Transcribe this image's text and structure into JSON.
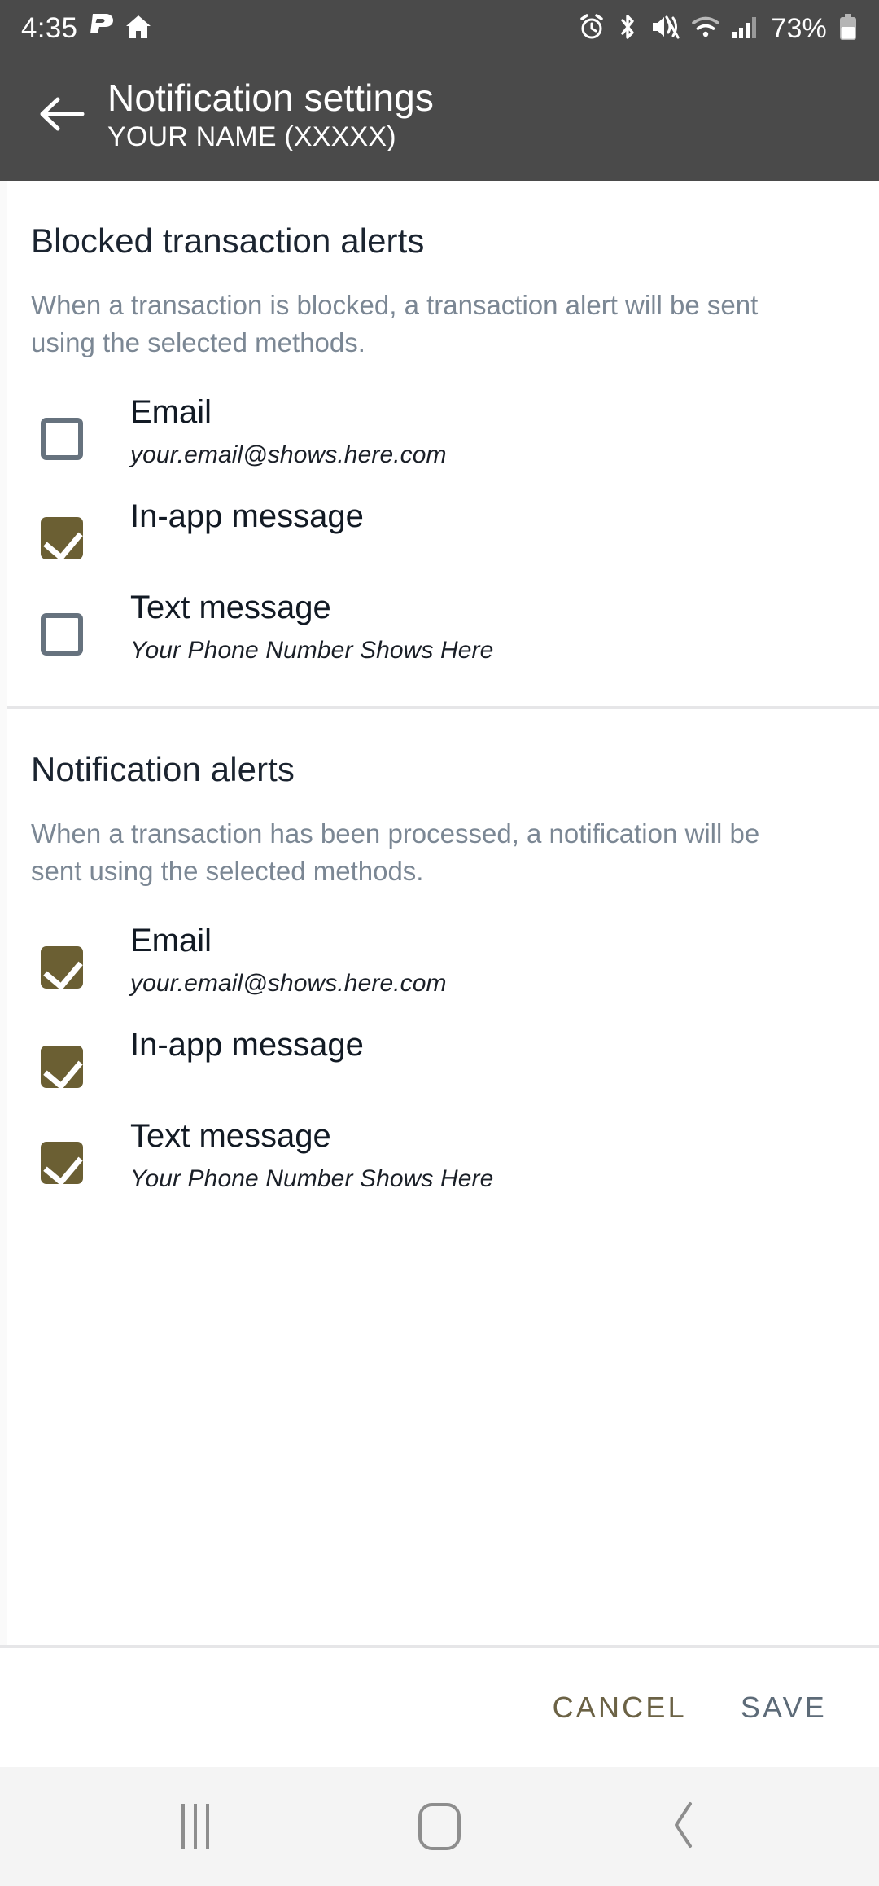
{
  "status_bar": {
    "time": "4:35",
    "battery_percent": "73%",
    "left_icons": [
      "app-p-icon",
      "home-icon"
    ],
    "right_icons": [
      "alarm-icon",
      "bluetooth-icon",
      "vibrate-mute-icon",
      "wifi-icon",
      "cellular-signal-icon",
      "battery-icon"
    ],
    "background_color": "#4a4a4a"
  },
  "app_bar": {
    "back_icon": "back-arrow-icon",
    "title": "Notification settings",
    "subtitle": "YOUR NAME (XXXXX)",
    "background_color": "#4a4a4a"
  },
  "sections": [
    {
      "title": "Blocked transaction alerts",
      "description": "When a transaction is blocked, a transaction alert will be sent using the selected methods.",
      "options": [
        {
          "label": "Email",
          "sub": "your.email@shows.here.com",
          "checked": false
        },
        {
          "label": "In-app message",
          "sub": "",
          "checked": true
        },
        {
          "label": "Text message",
          "sub": "Your Phone Number Shows Here",
          "checked": false
        }
      ]
    },
    {
      "title": "Notification alerts",
      "description": "When a transaction has been processed, a notification will be sent using the selected methods.",
      "options": [
        {
          "label": "Email",
          "sub": "your.email@shows.here.com",
          "checked": true
        },
        {
          "label": "In-app message",
          "sub": "",
          "checked": true
        },
        {
          "label": "Text message",
          "sub": "Your Phone Number Shows Here",
          "checked": true
        }
      ]
    }
  ],
  "actions": {
    "cancel_label": "CANCEL",
    "save_label": "SAVE",
    "cancel_color": "#6b6245",
    "save_color": "#5d6b78"
  },
  "nav_bar": {
    "recents_icon": "recents-icon",
    "home_icon": "home-button-icon",
    "back_icon": "back-chevron-icon",
    "background_color": "#f4f4f4"
  },
  "theme": {
    "checkbox_checked_color": "#6b5f33",
    "checkbox_unchecked_border": "#66727e",
    "divider_color": "#e6e6e8"
  }
}
